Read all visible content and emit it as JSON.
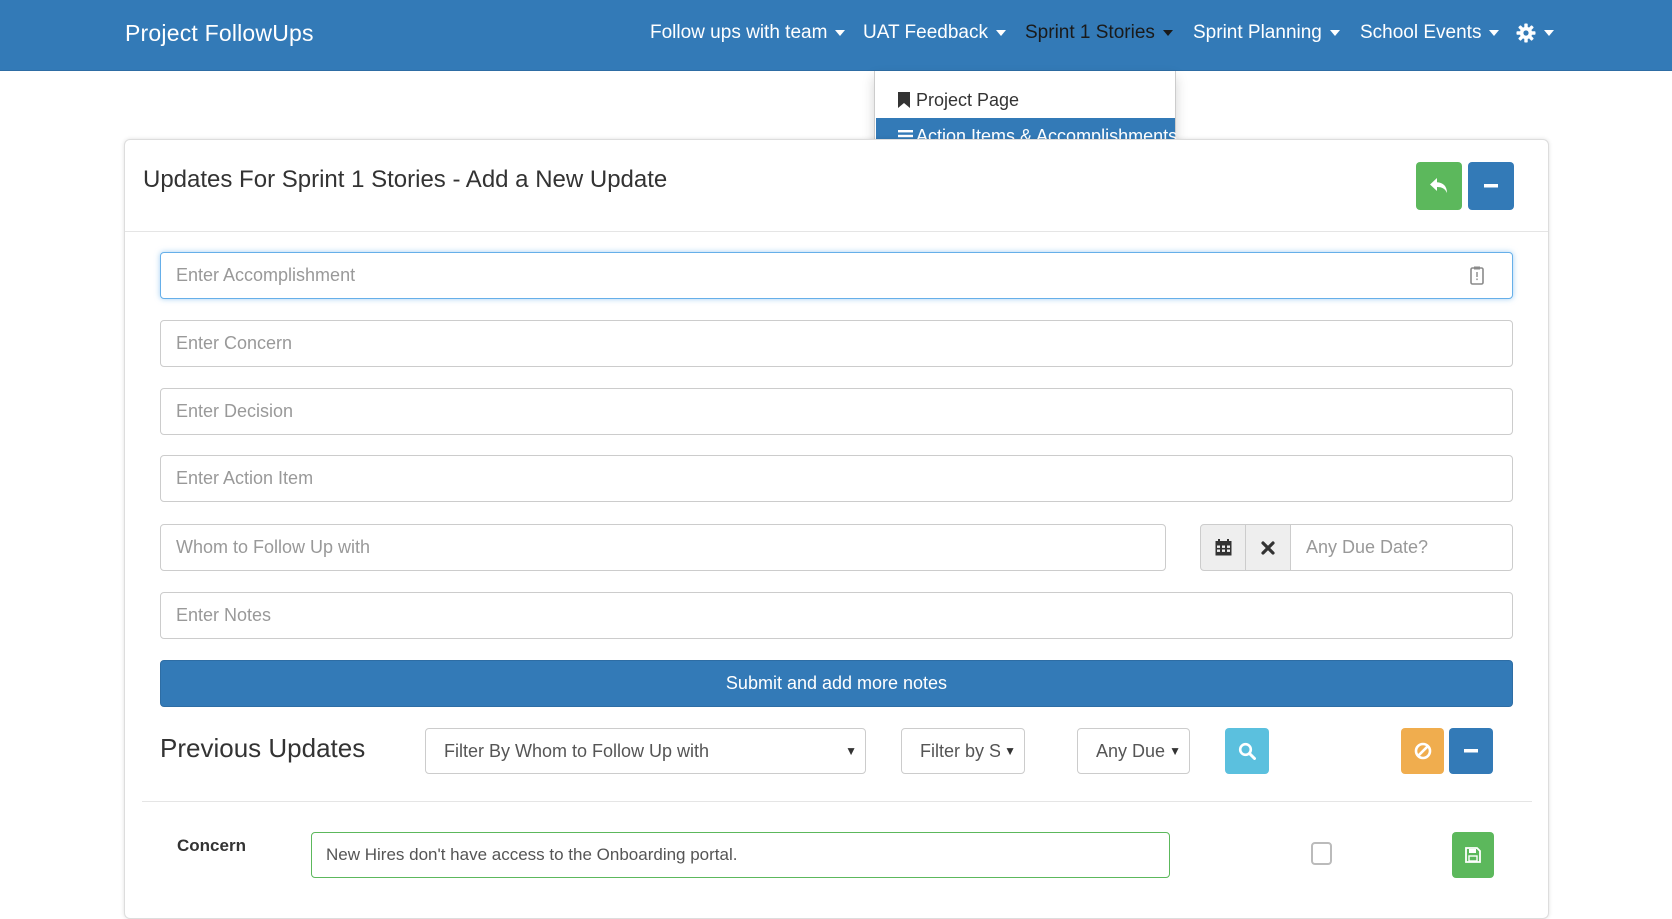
{
  "navbar": {
    "brand": "Project FollowUps",
    "items": [
      {
        "label": "Follow ups with team"
      },
      {
        "label": "UAT Feedback"
      },
      {
        "label": "Sprint 1 Stories"
      },
      {
        "label": "Sprint Planning"
      },
      {
        "label": "School Events"
      }
    ],
    "settings_icon": "gear-icon"
  },
  "dropdown": {
    "items": [
      {
        "label": "Project Page",
        "icon": "bookmark-icon"
      },
      {
        "label": "Action Items & Accomplishments",
        "icon": "list-icon"
      }
    ]
  },
  "panel": {
    "title": "Updates For Sprint 1 Stories - Add a New Update",
    "header_buttons": {
      "back_icon": "reply-icon",
      "collapse_icon": "minus-icon"
    }
  },
  "form": {
    "accomplishment_placeholder": "Enter Accomplishment",
    "concern_placeholder": "Enter Concern",
    "decision_placeholder": "Enter Decision",
    "action_item_placeholder": "Enter Action Item",
    "follow_up_placeholder": "Whom to Follow Up with",
    "due_date_placeholder": "Any Due Date?",
    "notes_placeholder": "Enter Notes",
    "submit_label": "Submit and add more notes"
  },
  "previous": {
    "title": "Previous Updates",
    "filter_whom": "Filter By Whom to Follow Up with",
    "filter_status": "Filter by S",
    "filter_due": "Any Due"
  },
  "rows": [
    {
      "type": "Concern",
      "text": "New Hires don't have access to the Onboarding portal."
    }
  ],
  "colors": {
    "primary": "#337ab7",
    "success": "#5cb85c",
    "info": "#5bc0de",
    "warning": "#f0ad4e"
  }
}
